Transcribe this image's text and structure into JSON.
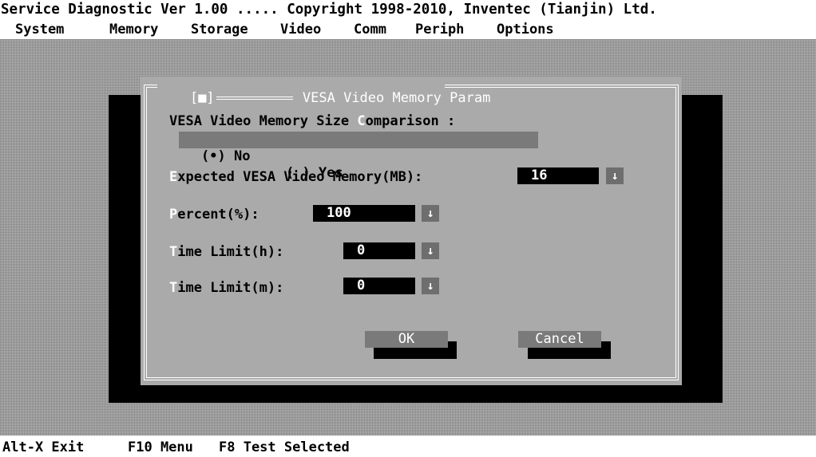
{
  "title_bar": {
    "text": "Service Diagnostic Ver 1.00 ..... Copyright 1998-2010, Inventec (Tianjin) Ltd."
  },
  "menu": [
    {
      "label": "System"
    },
    {
      "label": "Memory"
    },
    {
      "label": "Storage"
    },
    {
      "label": "Video"
    },
    {
      "label": "Comm"
    },
    {
      "label": "Periph"
    },
    {
      "label": "Options"
    }
  ],
  "dialog": {
    "title_left": "[■]",
    "title": " VESA Video Memory Param ",
    "size_comparison": {
      "label_pre": "VESA Video Memory Size ",
      "label_hot": "C",
      "label_post": "omparison :",
      "options": [
        {
          "marker": "(•)",
          "label": "No",
          "selected": true
        },
        {
          "marker": "( )",
          "label": "Yes",
          "selected": false
        }
      ]
    },
    "expected_memory": {
      "hot": "E",
      "rest": "xpected VESA Video Memory(MB):",
      "value": "16"
    },
    "percent": {
      "hot": "P",
      "rest": "ercent(%):",
      "value": "100"
    },
    "time_limit_h": {
      "hot": "T",
      "rest": "ime Limit(h):",
      "value": "0"
    },
    "time_limit_m": {
      "hot": "T",
      "rest": "ime Limit(m):",
      "value": "0"
    },
    "drop_glyph": "↓",
    "ok_label": "OK",
    "cancel_label": "Cancel"
  },
  "status_bar": {
    "alt_x": "Alt-X Exit",
    "f10": "F10 Menu",
    "f8": "F8 Test Selected"
  },
  "colors": {
    "dialog_bg": "#aaaaaa",
    "field_bg": "#000000",
    "button_bg": "#7a7a7a",
    "hotkey": "#ffffff"
  }
}
